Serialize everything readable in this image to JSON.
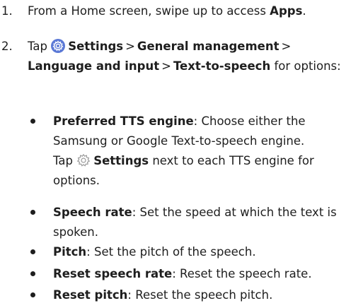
{
  "step1": {
    "number": "1.",
    "text": "From a Home screen, swipe up to access ",
    "apps": "Apps",
    "end": "."
  },
  "step2": {
    "number": "2.",
    "tap": "Tap",
    "settings": "Settings",
    "general": "General management",
    "language": "Language and input",
    "tts": "Text-to-speech",
    "for_options": " for options:"
  },
  "icons": {
    "settings_filled": "settings-gear-icon",
    "settings_outline": "settings-gear-outline-icon"
  },
  "colors": {
    "settings_icon_bg": "#5b79d6",
    "text": "#1e1e1e"
  },
  "bullets": [
    {
      "term": "Preferred TTS engine",
      "desc_line1": ": Choose either the",
      "desc_line2": "Samsung or Google Text-to-speech engine.",
      "tap": "Tap",
      "settings": "Settings",
      "desc_line3_end": " next to each TTS engine for",
      "desc_line4": "options."
    },
    {
      "term": "Speech rate",
      "desc_line1": ": Set the speed at which the text is",
      "desc_line2": "spoken."
    },
    {
      "term": "Pitch",
      "desc": ": Set the pitch of the speech."
    },
    {
      "term": "Reset speech rate",
      "desc": ": Reset the speech rate."
    },
    {
      "term": "Reset pitch",
      "desc": ": Reset the speech pitch."
    }
  ]
}
